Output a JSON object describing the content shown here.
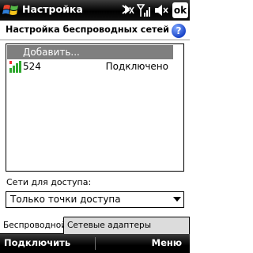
{
  "title_bar": {
    "app_title": "Настройка",
    "ok_label": "ok",
    "icons": [
      "windows-start-icon",
      "connectivity-icon",
      "signal-strength-icon",
      "volume-muted-icon"
    ]
  },
  "page": {
    "title": "Настройка беспроводных сетей",
    "help_label": "?"
  },
  "network_list": {
    "add_label": "Добавить...",
    "networks": [
      {
        "name": "524",
        "status": "Подключено",
        "icon": "wifi-signal-icon"
      }
    ]
  },
  "filter": {
    "label": "Сети для доступа:",
    "selected": "Только точки доступа"
  },
  "tabs": [
    {
      "label": "Беспроводной",
      "active": true
    },
    {
      "label": "Сетевые адаптеры",
      "active": false
    }
  ],
  "softkeys": {
    "left": "Подключить",
    "right": "Меню"
  },
  "colors": {
    "bar_dark": "#000000",
    "highlight": "#7f7f7f",
    "signal_green": "#2fa82f",
    "help_blue": "#1a45c8"
  }
}
